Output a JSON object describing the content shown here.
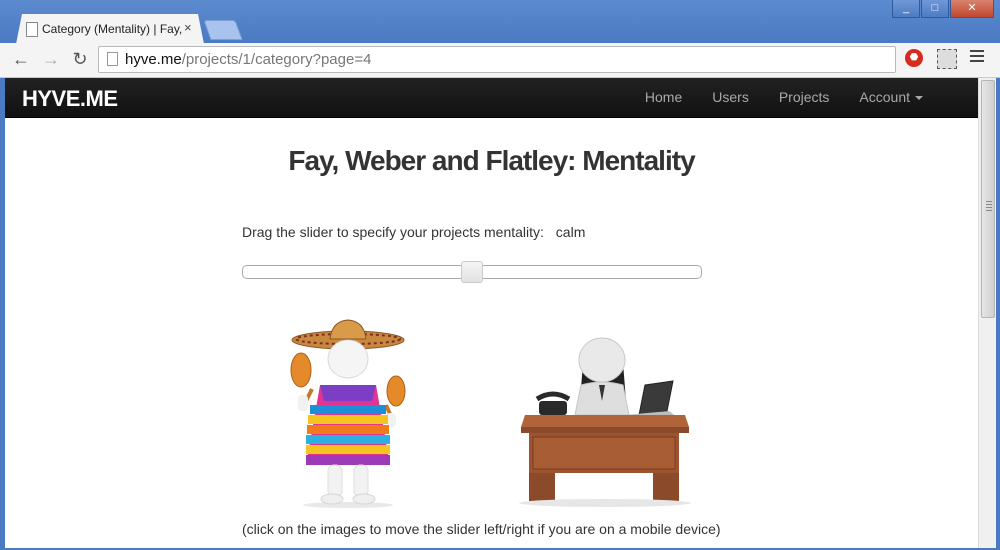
{
  "browser": {
    "tab_title": "Category (Mentality) | Fay,",
    "tab_close": "×",
    "url_domain": "hyve.me",
    "url_path": "/projects/1/category?page=4",
    "window_buttons": [
      "_",
      "□",
      "✕"
    ]
  },
  "navbar": {
    "brand": "HYVE.ME",
    "links": [
      "Home",
      "Users",
      "Projects",
      "Account"
    ]
  },
  "main": {
    "title": "Fay, Weber and Flatley: Mentality",
    "prompt": "Drag the slider to specify your projects mentality:",
    "mentality_value": "calm",
    "slider_value": 0.5,
    "caption": "(click on the images to move the slider left/right if you are on a mobile device)"
  },
  "images": {
    "left": "mexican-figure-with-maracas",
    "right": "office-worker-at-desk"
  },
  "colors": {
    "navbar": "#111111",
    "chrome_frame": "#4a7ac2"
  }
}
